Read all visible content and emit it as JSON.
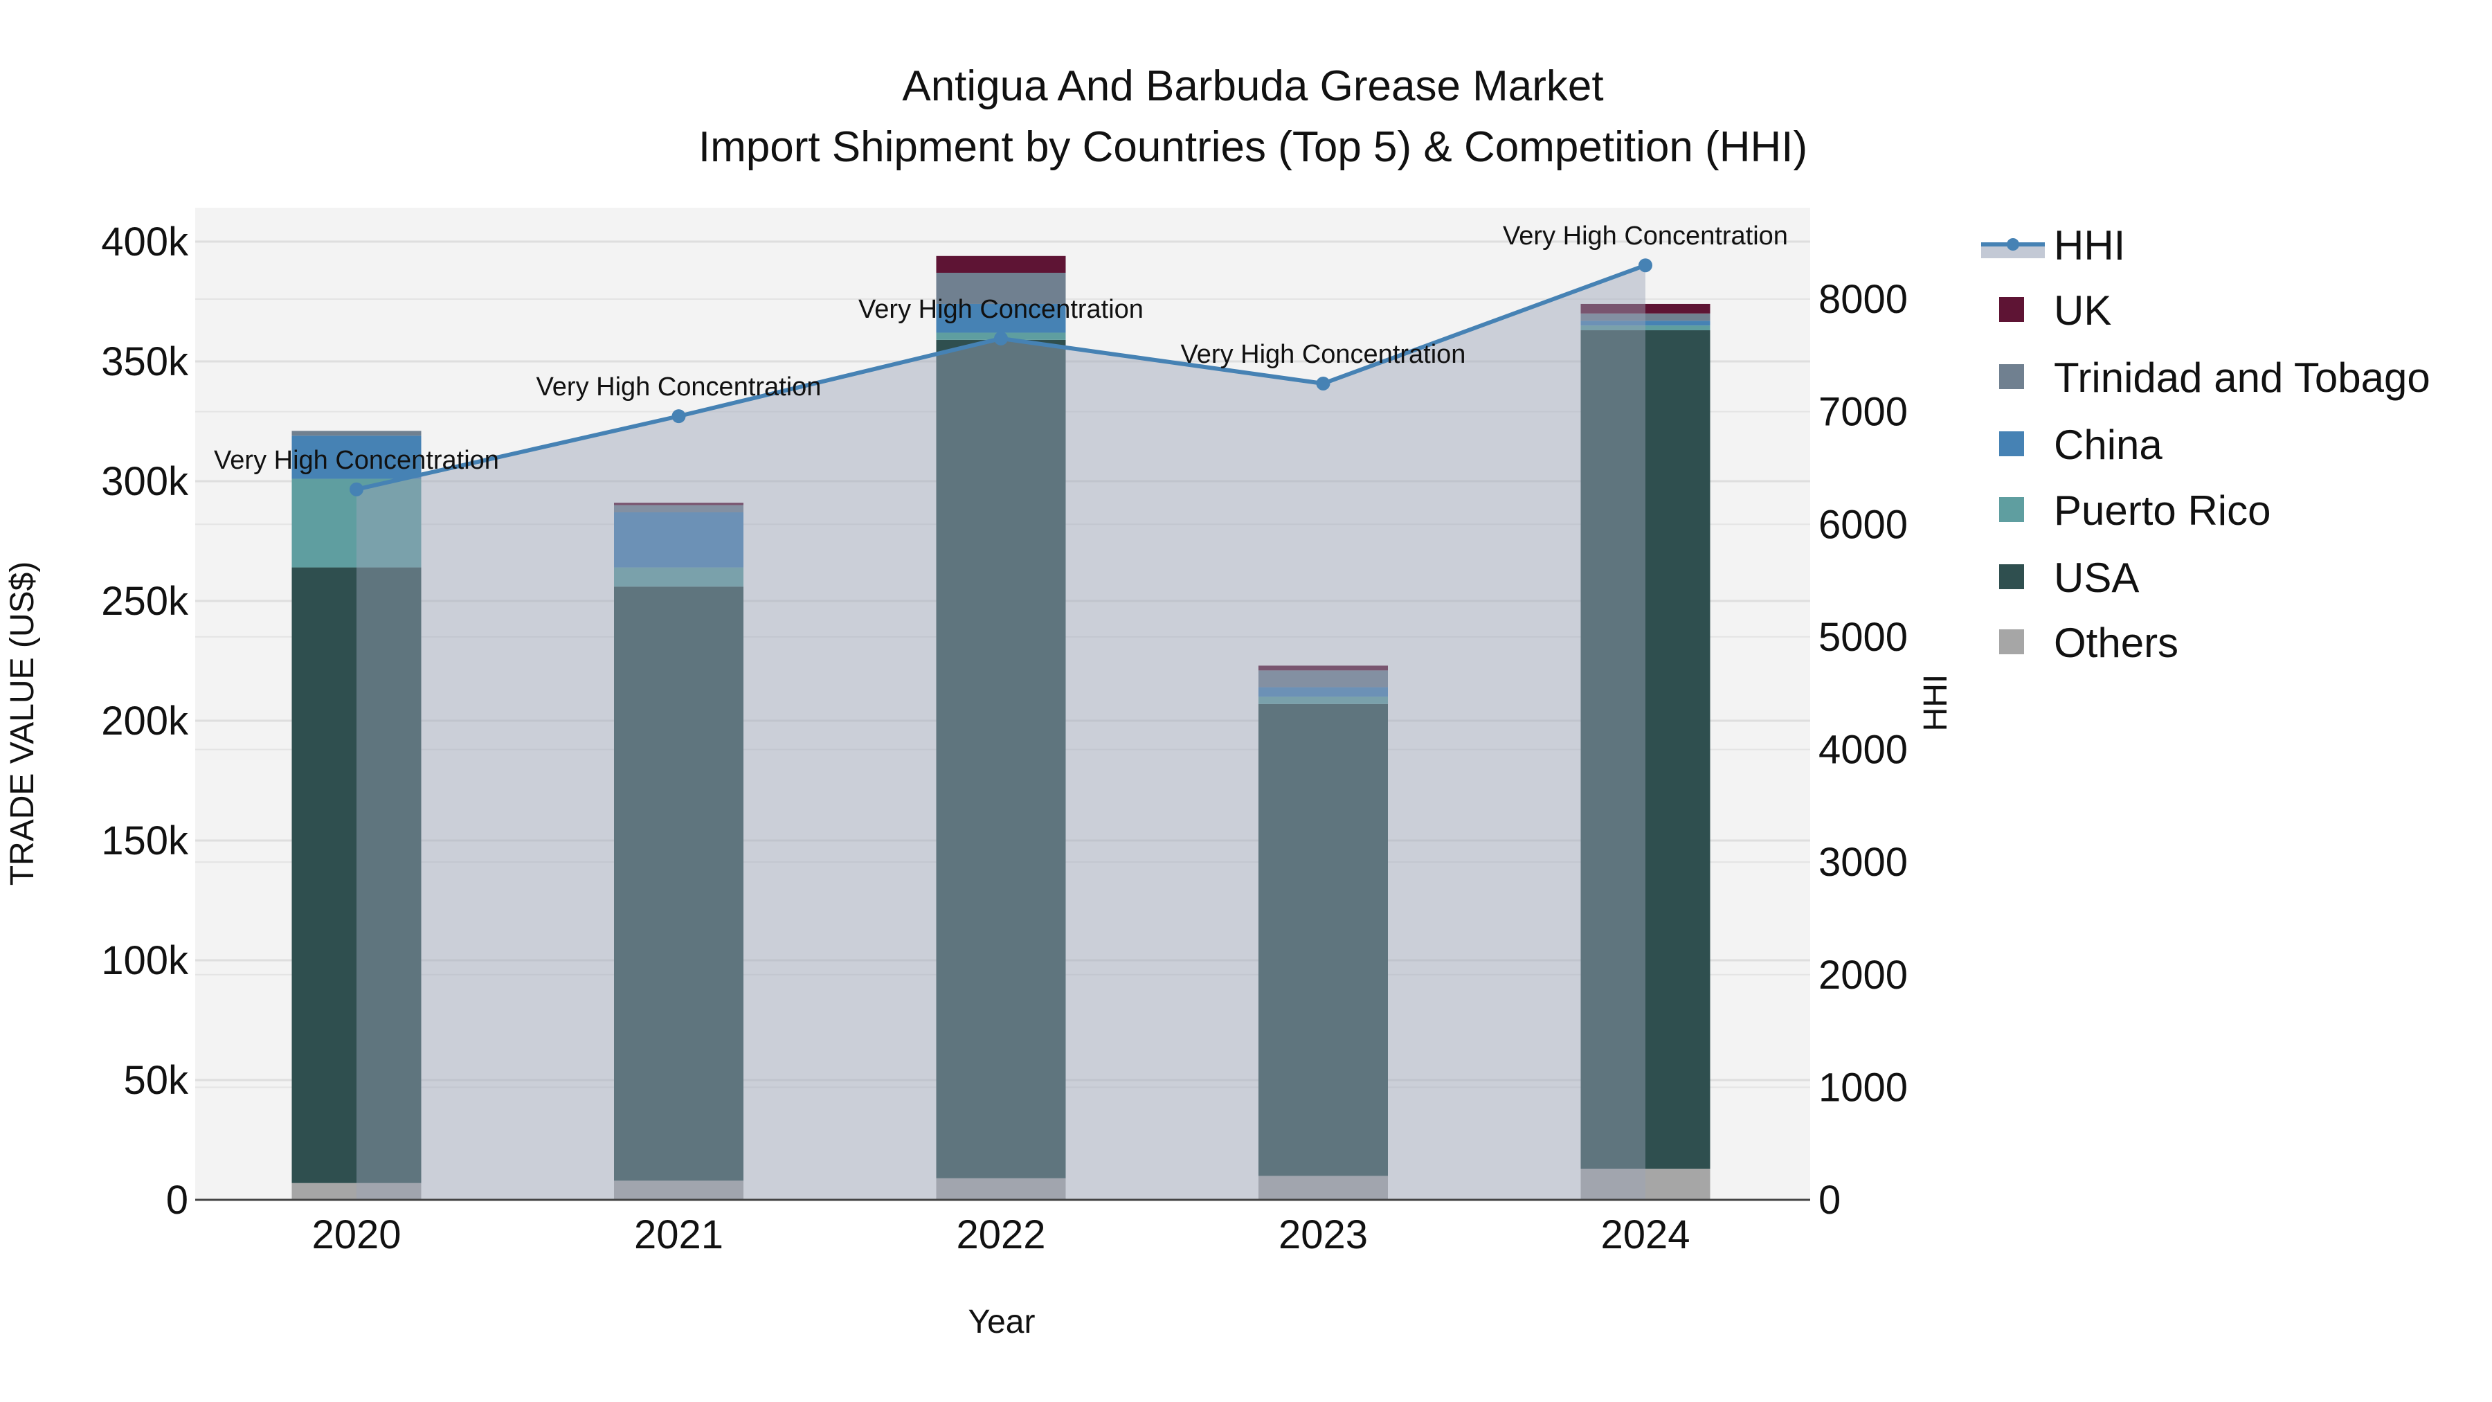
{
  "chart_data": {
    "type": "bar",
    "title": "Antigua And Barbuda Grease Market",
    "subtitle": "Import Shipment by Countries (Top 5) & Competition (HHI)",
    "xlabel": "Year",
    "ylabel": "TRADE VALUE (US$)",
    "y2label": "HHI",
    "categories": [
      "2020",
      "2021",
      "2022",
      "2023",
      "2024"
    ],
    "ylim": [
      0,
      415000
    ],
    "y_ticks": [
      0,
      50000,
      100000,
      150000,
      200000,
      250000,
      300000,
      350000,
      400000
    ],
    "y_tick_labels": [
      "0",
      "50k",
      "100k",
      "150k",
      "200k",
      "250k",
      "300k",
      "350k",
      "400k"
    ],
    "y2lim": [
      0,
      8850
    ],
    "y2_ticks": [
      0,
      1000,
      2000,
      3000,
      4000,
      5000,
      6000,
      7000,
      8000
    ],
    "y2_tick_labels": [
      "0",
      "1000",
      "2000",
      "3000",
      "4000",
      "5000",
      "6000",
      "7000",
      "8000"
    ],
    "grid": true,
    "legend_placement": "right",
    "series": [
      {
        "name": "Others",
        "color": "#a6a6a6",
        "values": [
          7000,
          8000,
          9000,
          10000,
          13000
        ]
      },
      {
        "name": "USA",
        "color": "#2f4f4f",
        "values": [
          257000,
          248000,
          350000,
          197000,
          350000
        ]
      },
      {
        "name": "Puerto Rico",
        "color": "#5f9ea0",
        "values": [
          37000,
          8000,
          3000,
          3000,
          2000
        ]
      },
      {
        "name": "China",
        "color": "#4682b4",
        "values": [
          18000,
          23000,
          12000,
          4000,
          2000
        ]
      },
      {
        "name": "Trinidad and Tobago",
        "color": "#708090",
        "values": [
          2000,
          3000,
          13000,
          7000,
          3000
        ]
      },
      {
        "name": "UK",
        "color": "#5e1434",
        "values": [
          0,
          1000,
          7000,
          2000,
          4000
        ]
      }
    ],
    "hhi": {
      "name": "HHI",
      "color": "#4682b4",
      "values": [
        6310,
        6960,
        7650,
        7250,
        8300
      ],
      "annotations": [
        "Very High Concentration",
        "Very High Concentration",
        "Very High Concentration",
        "Very High Concentration",
        "Very High Concentration"
      ]
    },
    "legend_order": [
      "HHI",
      "UK",
      "Trinidad and Tobago",
      "China",
      "Puerto Rico",
      "USA",
      "Others"
    ]
  }
}
